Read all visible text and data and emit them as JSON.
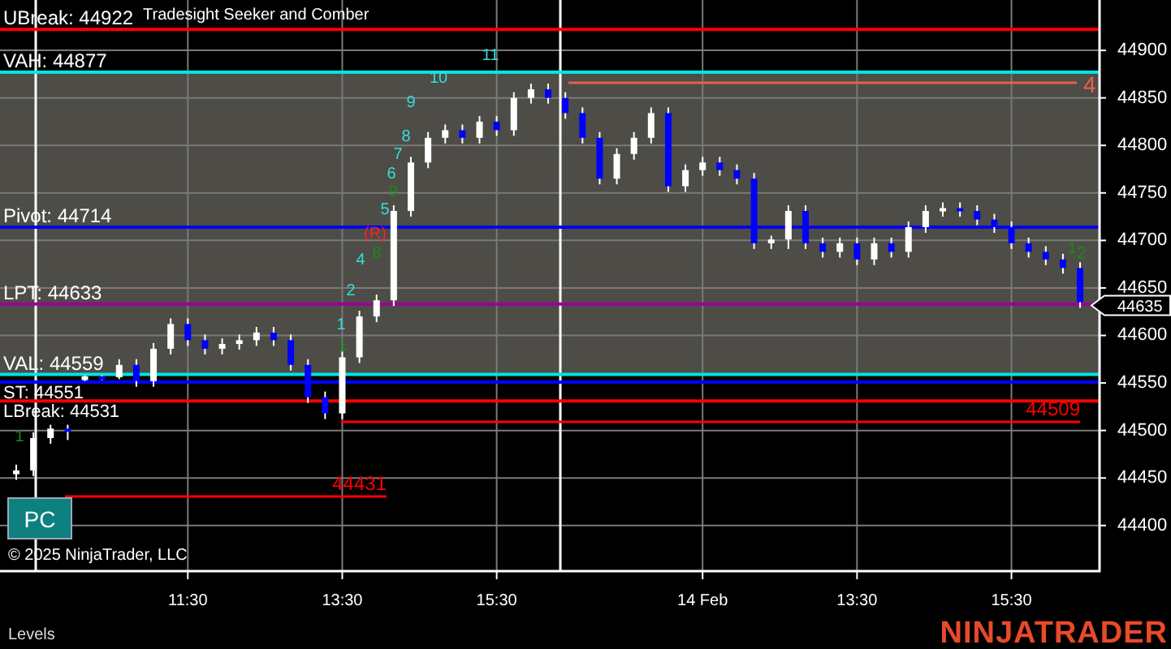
{
  "chart": {
    "title": "Tradesight Seeker and Comber",
    "chart_data": {
      "type": "candlestick",
      "grid": true,
      "ylim": [
        44352,
        44953
      ],
      "categories": [
        null,
        null,
        null,
        null,
        null,
        null,
        null,
        null,
        null,
        null,
        "11:30",
        null,
        null,
        null,
        null,
        null,
        null,
        null,
        null,
        "13:30",
        null,
        null,
        null,
        null,
        null,
        null,
        null,
        null,
        "15:30",
        null,
        null,
        null,
        null,
        null,
        null,
        null,
        null,
        null,
        null,
        null,
        "14 Feb",
        null,
        null,
        null,
        null,
        null,
        null,
        null,
        null,
        "13:30",
        null,
        null,
        null,
        null,
        null,
        null,
        null,
        null,
        "15:30",
        null,
        null,
        null,
        null
      ],
      "yticks": [
        44400,
        44450,
        44500,
        44550,
        44600,
        44650,
        44700,
        44750,
        44800,
        44850,
        44900
      ],
      "ohlc": [
        [
          44454,
          44464,
          44448,
          44458
        ],
        [
          44458,
          44498,
          44452,
          44492
        ],
        [
          44492,
          44506,
          44486,
          44502
        ],
        [
          44502,
          44506,
          44490,
          44500
        ],
        [
          44553,
          44558,
          44552,
          44557
        ],
        [
          44557,
          44558,
          44553,
          44556
        ],
        [
          44556,
          44575,
          44554,
          44569
        ],
        [
          44569,
          44575,
          44546,
          44552
        ],
        [
          44552,
          44592,
          44546,
          44586
        ],
        [
          44586,
          44618,
          44580,
          44612
        ],
        [
          44612,
          44618,
          44589,
          44595
        ],
        [
          44595,
          44601,
          44580,
          44586
        ],
        [
          44586,
          44597,
          44580,
          44591
        ],
        [
          44591,
          44601,
          44585,
          44595
        ],
        [
          44595,
          44609,
          44589,
          44603
        ],
        [
          44603,
          44609,
          44589,
          44595
        ],
        [
          44595,
          44601,
          44563,
          44569
        ],
        [
          44569,
          44575,
          44529,
          44535
        ],
        [
          44535,
          44541,
          44512,
          44518
        ],
        [
          44518,
          44583,
          44512,
          44577
        ],
        [
          44577,
          44626,
          44571,
          44620
        ],
        [
          44620,
          44643,
          44614,
          44637
        ],
        [
          44637,
          44737,
          44631,
          44731
        ],
        [
          44731,
          44788,
          44725,
          44782
        ],
        [
          44782,
          44814,
          44776,
          44808
        ],
        [
          44808,
          44822,
          44802,
          44816
        ],
        [
          44816,
          44822,
          44802,
          44808
        ],
        [
          44808,
          44831,
          44802,
          44825
        ],
        [
          44825,
          44831,
          44810,
          44816
        ],
        [
          44816,
          44856,
          44810,
          44850
        ],
        [
          44850,
          44865,
          44844,
          44859
        ],
        [
          44859,
          44865,
          44844,
          44850
        ],
        [
          44850,
          44856,
          44828,
          44834
        ],
        [
          44834,
          44840,
          44802,
          44808
        ],
        [
          44808,
          44814,
          44759,
          44765
        ],
        [
          44765,
          44797,
          44759,
          44791
        ],
        [
          44791,
          44814,
          44785,
          44808
        ],
        [
          44808,
          44840,
          44802,
          44834
        ],
        [
          44834,
          44840,
          44751,
          44757
        ],
        [
          44757,
          44780,
          44751,
          44774
        ],
        [
          44774,
          44788,
          44768,
          44782
        ],
        [
          44782,
          44788,
          44768,
          44774
        ],
        [
          44774,
          44780,
          44759,
          44765
        ],
        [
          44765,
          44771,
          44691,
          44697
        ],
        [
          44697,
          44705,
          44691,
          44701
        ],
        [
          44701,
          44737,
          44691,
          44731
        ],
        [
          44731,
          44737,
          44691,
          44697
        ],
        [
          44697,
          44703,
          44682,
          44688
        ],
        [
          44688,
          44703,
          44682,
          44697
        ],
        [
          44697,
          44703,
          44674,
          44680
        ],
        [
          44680,
          44703,
          44674,
          44697
        ],
        [
          44697,
          44703,
          44682,
          44688
        ],
        [
          44688,
          44720,
          44682,
          44714
        ],
        [
          44714,
          44737,
          44708,
          44731
        ],
        [
          44731,
          44740,
          44725,
          44734
        ],
        [
          44734,
          44740,
          44725,
          44731
        ],
        [
          44731,
          44737,
          44716,
          44722
        ],
        [
          44722,
          44728,
          44708,
          44714
        ],
        [
          44714,
          44720,
          44691,
          44697
        ],
        [
          44697,
          44703,
          44682,
          44688
        ],
        [
          44688,
          44694,
          44674,
          44680
        ],
        [
          44680,
          44686,
          44665,
          44671
        ],
        [
          44671,
          44677,
          44629,
          44635
        ]
      ],
      "ref_lines": [
        {
          "axis": "y",
          "value": 44922,
          "color": "#ff0000",
          "label": "UBreak: 44922"
        },
        {
          "axis": "y",
          "value": 44877,
          "color": "#00e5e5",
          "label": "VAH: 44877"
        },
        {
          "axis": "y",
          "value": 44714,
          "color": "#0000ff",
          "label": "Pivot: 44714"
        },
        {
          "axis": "y",
          "value": 44633,
          "color": "#9b009b",
          "label": "LPT: 44633"
        },
        {
          "axis": "y",
          "value": 44559,
          "color": "#00e5e5",
          "label": "VAL: 44559"
        },
        {
          "axis": "y",
          "value": 44551,
          "color": "#0000ff",
          "label": "ST: 44551"
        },
        {
          "axis": "y",
          "value": 44531,
          "color": "#ff0000",
          "label": "LBreak: 44531"
        }
      ]
    },
    "value_area": {
      "color": "#4e4c46"
    },
    "target_lines": [
      {
        "label": "4",
        "color": "#e8604c"
      },
      {
        "label": "44509",
        "color": "#ff0000"
      },
      {
        "label": "44431",
        "color": "#ff0000"
      }
    ],
    "wave_counts": [
      {
        "text": "1",
        "color": "#33dddd"
      },
      {
        "text": "2",
        "color": "#33dddd"
      },
      {
        "text": "4",
        "color": "#33dddd"
      },
      {
        "text": "5",
        "color": "#33dddd"
      },
      {
        "text": "6",
        "color": "#33dddd"
      },
      {
        "text": "7",
        "color": "#33dddd"
      },
      {
        "text": "8",
        "color": "#33dddd"
      },
      {
        "text": "9",
        "color": "#33dddd"
      },
      {
        "text": "10",
        "color": "#33dddd"
      },
      {
        "text": "11",
        "color": "#33dddd"
      },
      {
        "text": "(R)",
        "color": "#ff2020"
      },
      {
        "text": "8",
        "color": "#1a8a1a"
      },
      {
        "text": "9",
        "color": "#1a8a1a"
      },
      {
        "text": "1",
        "color": "#1a8a1a"
      },
      {
        "text": "1",
        "color": "#1a8a1a"
      },
      {
        "text": "1",
        "color": "#1a8a1a"
      },
      {
        "text": "2",
        "color": "#1a8a1a"
      }
    ],
    "last_price": "44635",
    "button": "PC",
    "copyright": "© 2025 NinjaTrader, LLC"
  },
  "footer": {
    "panel": "Levels",
    "logo": "NINJATRADER"
  }
}
